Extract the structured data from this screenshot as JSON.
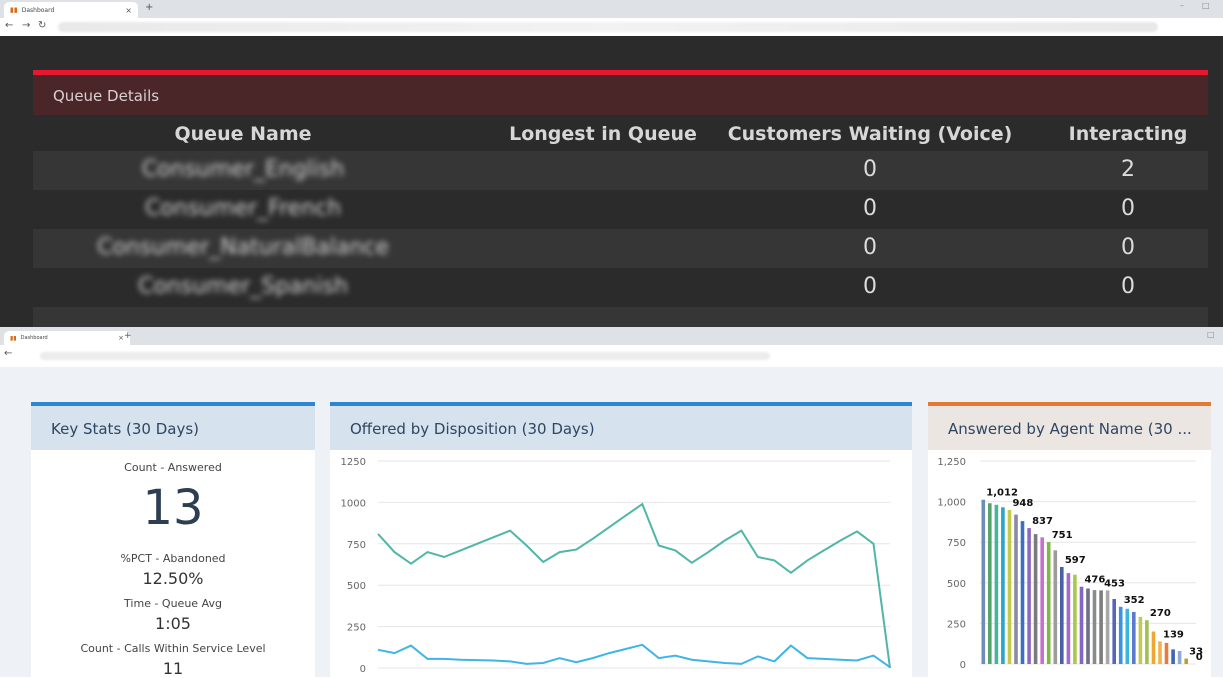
{
  "browser1": {
    "tab_title": "Dashboard"
  },
  "browser2": {
    "tab_title": "Dashboard"
  },
  "queue": {
    "title": "Queue Details",
    "columns": [
      "Queue Name",
      "Longest in Queue",
      "Customers Waiting (Voice)",
      "Interacting"
    ],
    "rows": [
      {
        "name": "Consumer_English",
        "longest": "",
        "waiting": "0",
        "interacting": "2"
      },
      {
        "name": "Consumer_French",
        "longest": "",
        "waiting": "0",
        "interacting": "0"
      },
      {
        "name": "Consumer_NaturalBalance",
        "longest": "",
        "waiting": "0",
        "interacting": "0"
      },
      {
        "name": "Consumer_Spanish",
        "longest": "",
        "waiting": "0",
        "interacting": "0"
      }
    ]
  },
  "key_stats": {
    "title": "Key Stats (30 Days)",
    "answered_label": "Count - Answered",
    "answered_value": "13",
    "abandoned_label": "%PCT - Abandoned",
    "abandoned_value": "12.50%",
    "queue_avg_label": "Time - Queue Avg",
    "queue_avg_value": "1:05",
    "service_label": "Count - Calls Within Service Level",
    "service_value": "11"
  },
  "offered": {
    "title": "Offered by Disposition (30 Days)"
  },
  "answered_agent": {
    "title": "Answered by Agent Name (30 ..."
  },
  "colors": {
    "accent_blue": "#2f86d0",
    "accent_orange": "#e07a35",
    "queue_red": "#e8162f",
    "teal": "#4fb6a8",
    "sky": "#3fb4e6"
  },
  "chart_data": [
    {
      "type": "line",
      "title": "Offered by Disposition (30 Days)",
      "ylim": [
        0,
        1250
      ],
      "yticks": [
        "1250",
        "1000",
        "750",
        "500",
        "250",
        "0"
      ],
      "series": [
        {
          "values": [
            810,
            700,
            630,
            700,
            670,
            710,
            750,
            790,
            830,
            740,
            640,
            700,
            715,
            780,
            850,
            920,
            990,
            740,
            710,
            635,
            700,
            770,
            830,
            670,
            650,
            575,
            650,
            710,
            770,
            825,
            750,
            0
          ]
        },
        {
          "values": [
            110,
            90,
            135,
            55,
            55,
            50,
            48,
            45,
            40,
            25,
            30,
            60,
            35,
            60,
            90,
            115,
            140,
            60,
            75,
            50,
            40,
            30,
            25,
            70,
            40,
            135,
            60,
            55,
            50,
            45,
            75,
            5
          ]
        }
      ]
    },
    {
      "type": "bar",
      "title": "Answered by Agent Name (30 ...",
      "ylim": [
        0,
        1250
      ],
      "yticks": [
        "1,250",
        "1,000",
        "750",
        "500",
        "250",
        "0"
      ],
      "values": [
        1012,
        990,
        980,
        965,
        948,
        920,
        880,
        837,
        800,
        780,
        751,
        700,
        597,
        560,
        550,
        476,
        465,
        455,
        453,
        453,
        400,
        352,
        340,
        320,
        290,
        270,
        200,
        139,
        130,
        90,
        80,
        33,
        0
      ],
      "data_labels": [
        {
          "index": 0,
          "text": "1,012"
        },
        {
          "index": 4,
          "text": "948"
        },
        {
          "index": 7,
          "text": "837"
        },
        {
          "index": 10,
          "text": "751"
        },
        {
          "index": 12,
          "text": "597"
        },
        {
          "index": 15,
          "text": "476"
        },
        {
          "index": 18,
          "text": "453"
        },
        {
          "index": 21,
          "text": "352"
        },
        {
          "index": 25,
          "text": "270"
        },
        {
          "index": 27,
          "text": "139"
        },
        {
          "index": 31,
          "text": "33"
        },
        {
          "index": 32,
          "text": "0"
        }
      ],
      "bar_colors": [
        "#6f8db9",
        "#55a46c",
        "#45b69b",
        "#2ca3c9",
        "#c7c94a",
        "#8a8aa0",
        "#3c6fc4",
        "#8d69c2",
        "#7a7a7a",
        "#c96fd0",
        "#7fb845",
        "#9c9c9c",
        "#4b5ea8",
        "#a16ad1",
        "#a7c94b",
        "#8266c4",
        "#6e6e8e",
        "#8a8a8a",
        "#7d7d7d",
        "#a8a8a8",
        "#5766b8",
        "#3a92e0",
        "#35b7e0",
        "#5a7ad0",
        "#c2c957",
        "#a0c052",
        "#f0a630",
        "#f2b24c",
        "#e87b3a",
        "#3f64b8",
        "#8fa9d9",
        "#b7a32f",
        "#cfcfcf"
      ]
    }
  ]
}
